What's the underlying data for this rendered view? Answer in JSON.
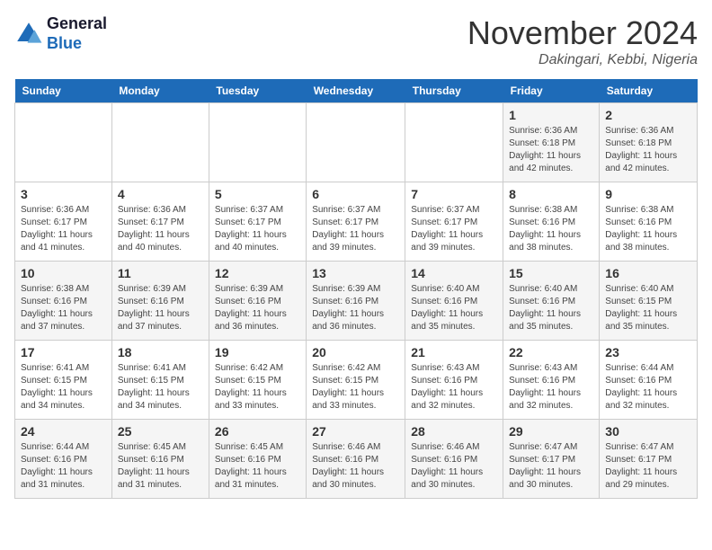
{
  "logo": {
    "line1": "General",
    "line2": "Blue"
  },
  "title": "November 2024",
  "location": "Dakingari, Kebbi, Nigeria",
  "days_header": [
    "Sunday",
    "Monday",
    "Tuesday",
    "Wednesday",
    "Thursday",
    "Friday",
    "Saturday"
  ],
  "weeks": [
    [
      {
        "day": "",
        "info": ""
      },
      {
        "day": "",
        "info": ""
      },
      {
        "day": "",
        "info": ""
      },
      {
        "day": "",
        "info": ""
      },
      {
        "day": "",
        "info": ""
      },
      {
        "day": "1",
        "info": "Sunrise: 6:36 AM\nSunset: 6:18 PM\nDaylight: 11 hours\nand 42 minutes."
      },
      {
        "day": "2",
        "info": "Sunrise: 6:36 AM\nSunset: 6:18 PM\nDaylight: 11 hours\nand 42 minutes."
      }
    ],
    [
      {
        "day": "3",
        "info": "Sunrise: 6:36 AM\nSunset: 6:17 PM\nDaylight: 11 hours\nand 41 minutes."
      },
      {
        "day": "4",
        "info": "Sunrise: 6:36 AM\nSunset: 6:17 PM\nDaylight: 11 hours\nand 40 minutes."
      },
      {
        "day": "5",
        "info": "Sunrise: 6:37 AM\nSunset: 6:17 PM\nDaylight: 11 hours\nand 40 minutes."
      },
      {
        "day": "6",
        "info": "Sunrise: 6:37 AM\nSunset: 6:17 PM\nDaylight: 11 hours\nand 39 minutes."
      },
      {
        "day": "7",
        "info": "Sunrise: 6:37 AM\nSunset: 6:17 PM\nDaylight: 11 hours\nand 39 minutes."
      },
      {
        "day": "8",
        "info": "Sunrise: 6:38 AM\nSunset: 6:16 PM\nDaylight: 11 hours\nand 38 minutes."
      },
      {
        "day": "9",
        "info": "Sunrise: 6:38 AM\nSunset: 6:16 PM\nDaylight: 11 hours\nand 38 minutes."
      }
    ],
    [
      {
        "day": "10",
        "info": "Sunrise: 6:38 AM\nSunset: 6:16 PM\nDaylight: 11 hours\nand 37 minutes."
      },
      {
        "day": "11",
        "info": "Sunrise: 6:39 AM\nSunset: 6:16 PM\nDaylight: 11 hours\nand 37 minutes."
      },
      {
        "day": "12",
        "info": "Sunrise: 6:39 AM\nSunset: 6:16 PM\nDaylight: 11 hours\nand 36 minutes."
      },
      {
        "day": "13",
        "info": "Sunrise: 6:39 AM\nSunset: 6:16 PM\nDaylight: 11 hours\nand 36 minutes."
      },
      {
        "day": "14",
        "info": "Sunrise: 6:40 AM\nSunset: 6:16 PM\nDaylight: 11 hours\nand 35 minutes."
      },
      {
        "day": "15",
        "info": "Sunrise: 6:40 AM\nSunset: 6:16 PM\nDaylight: 11 hours\nand 35 minutes."
      },
      {
        "day": "16",
        "info": "Sunrise: 6:40 AM\nSunset: 6:15 PM\nDaylight: 11 hours\nand 35 minutes."
      }
    ],
    [
      {
        "day": "17",
        "info": "Sunrise: 6:41 AM\nSunset: 6:15 PM\nDaylight: 11 hours\nand 34 minutes."
      },
      {
        "day": "18",
        "info": "Sunrise: 6:41 AM\nSunset: 6:15 PM\nDaylight: 11 hours\nand 34 minutes."
      },
      {
        "day": "19",
        "info": "Sunrise: 6:42 AM\nSunset: 6:15 PM\nDaylight: 11 hours\nand 33 minutes."
      },
      {
        "day": "20",
        "info": "Sunrise: 6:42 AM\nSunset: 6:15 PM\nDaylight: 11 hours\nand 33 minutes."
      },
      {
        "day": "21",
        "info": "Sunrise: 6:43 AM\nSunset: 6:16 PM\nDaylight: 11 hours\nand 32 minutes."
      },
      {
        "day": "22",
        "info": "Sunrise: 6:43 AM\nSunset: 6:16 PM\nDaylight: 11 hours\nand 32 minutes."
      },
      {
        "day": "23",
        "info": "Sunrise: 6:44 AM\nSunset: 6:16 PM\nDaylight: 11 hours\nand 32 minutes."
      }
    ],
    [
      {
        "day": "24",
        "info": "Sunrise: 6:44 AM\nSunset: 6:16 PM\nDaylight: 11 hours\nand 31 minutes."
      },
      {
        "day": "25",
        "info": "Sunrise: 6:45 AM\nSunset: 6:16 PM\nDaylight: 11 hours\nand 31 minutes."
      },
      {
        "day": "26",
        "info": "Sunrise: 6:45 AM\nSunset: 6:16 PM\nDaylight: 11 hours\nand 31 minutes."
      },
      {
        "day": "27",
        "info": "Sunrise: 6:46 AM\nSunset: 6:16 PM\nDaylight: 11 hours\nand 30 minutes."
      },
      {
        "day": "28",
        "info": "Sunrise: 6:46 AM\nSunset: 6:16 PM\nDaylight: 11 hours\nand 30 minutes."
      },
      {
        "day": "29",
        "info": "Sunrise: 6:47 AM\nSunset: 6:17 PM\nDaylight: 11 hours\nand 30 minutes."
      },
      {
        "day": "30",
        "info": "Sunrise: 6:47 AM\nSunset: 6:17 PM\nDaylight: 11 hours\nand 29 minutes."
      }
    ]
  ]
}
